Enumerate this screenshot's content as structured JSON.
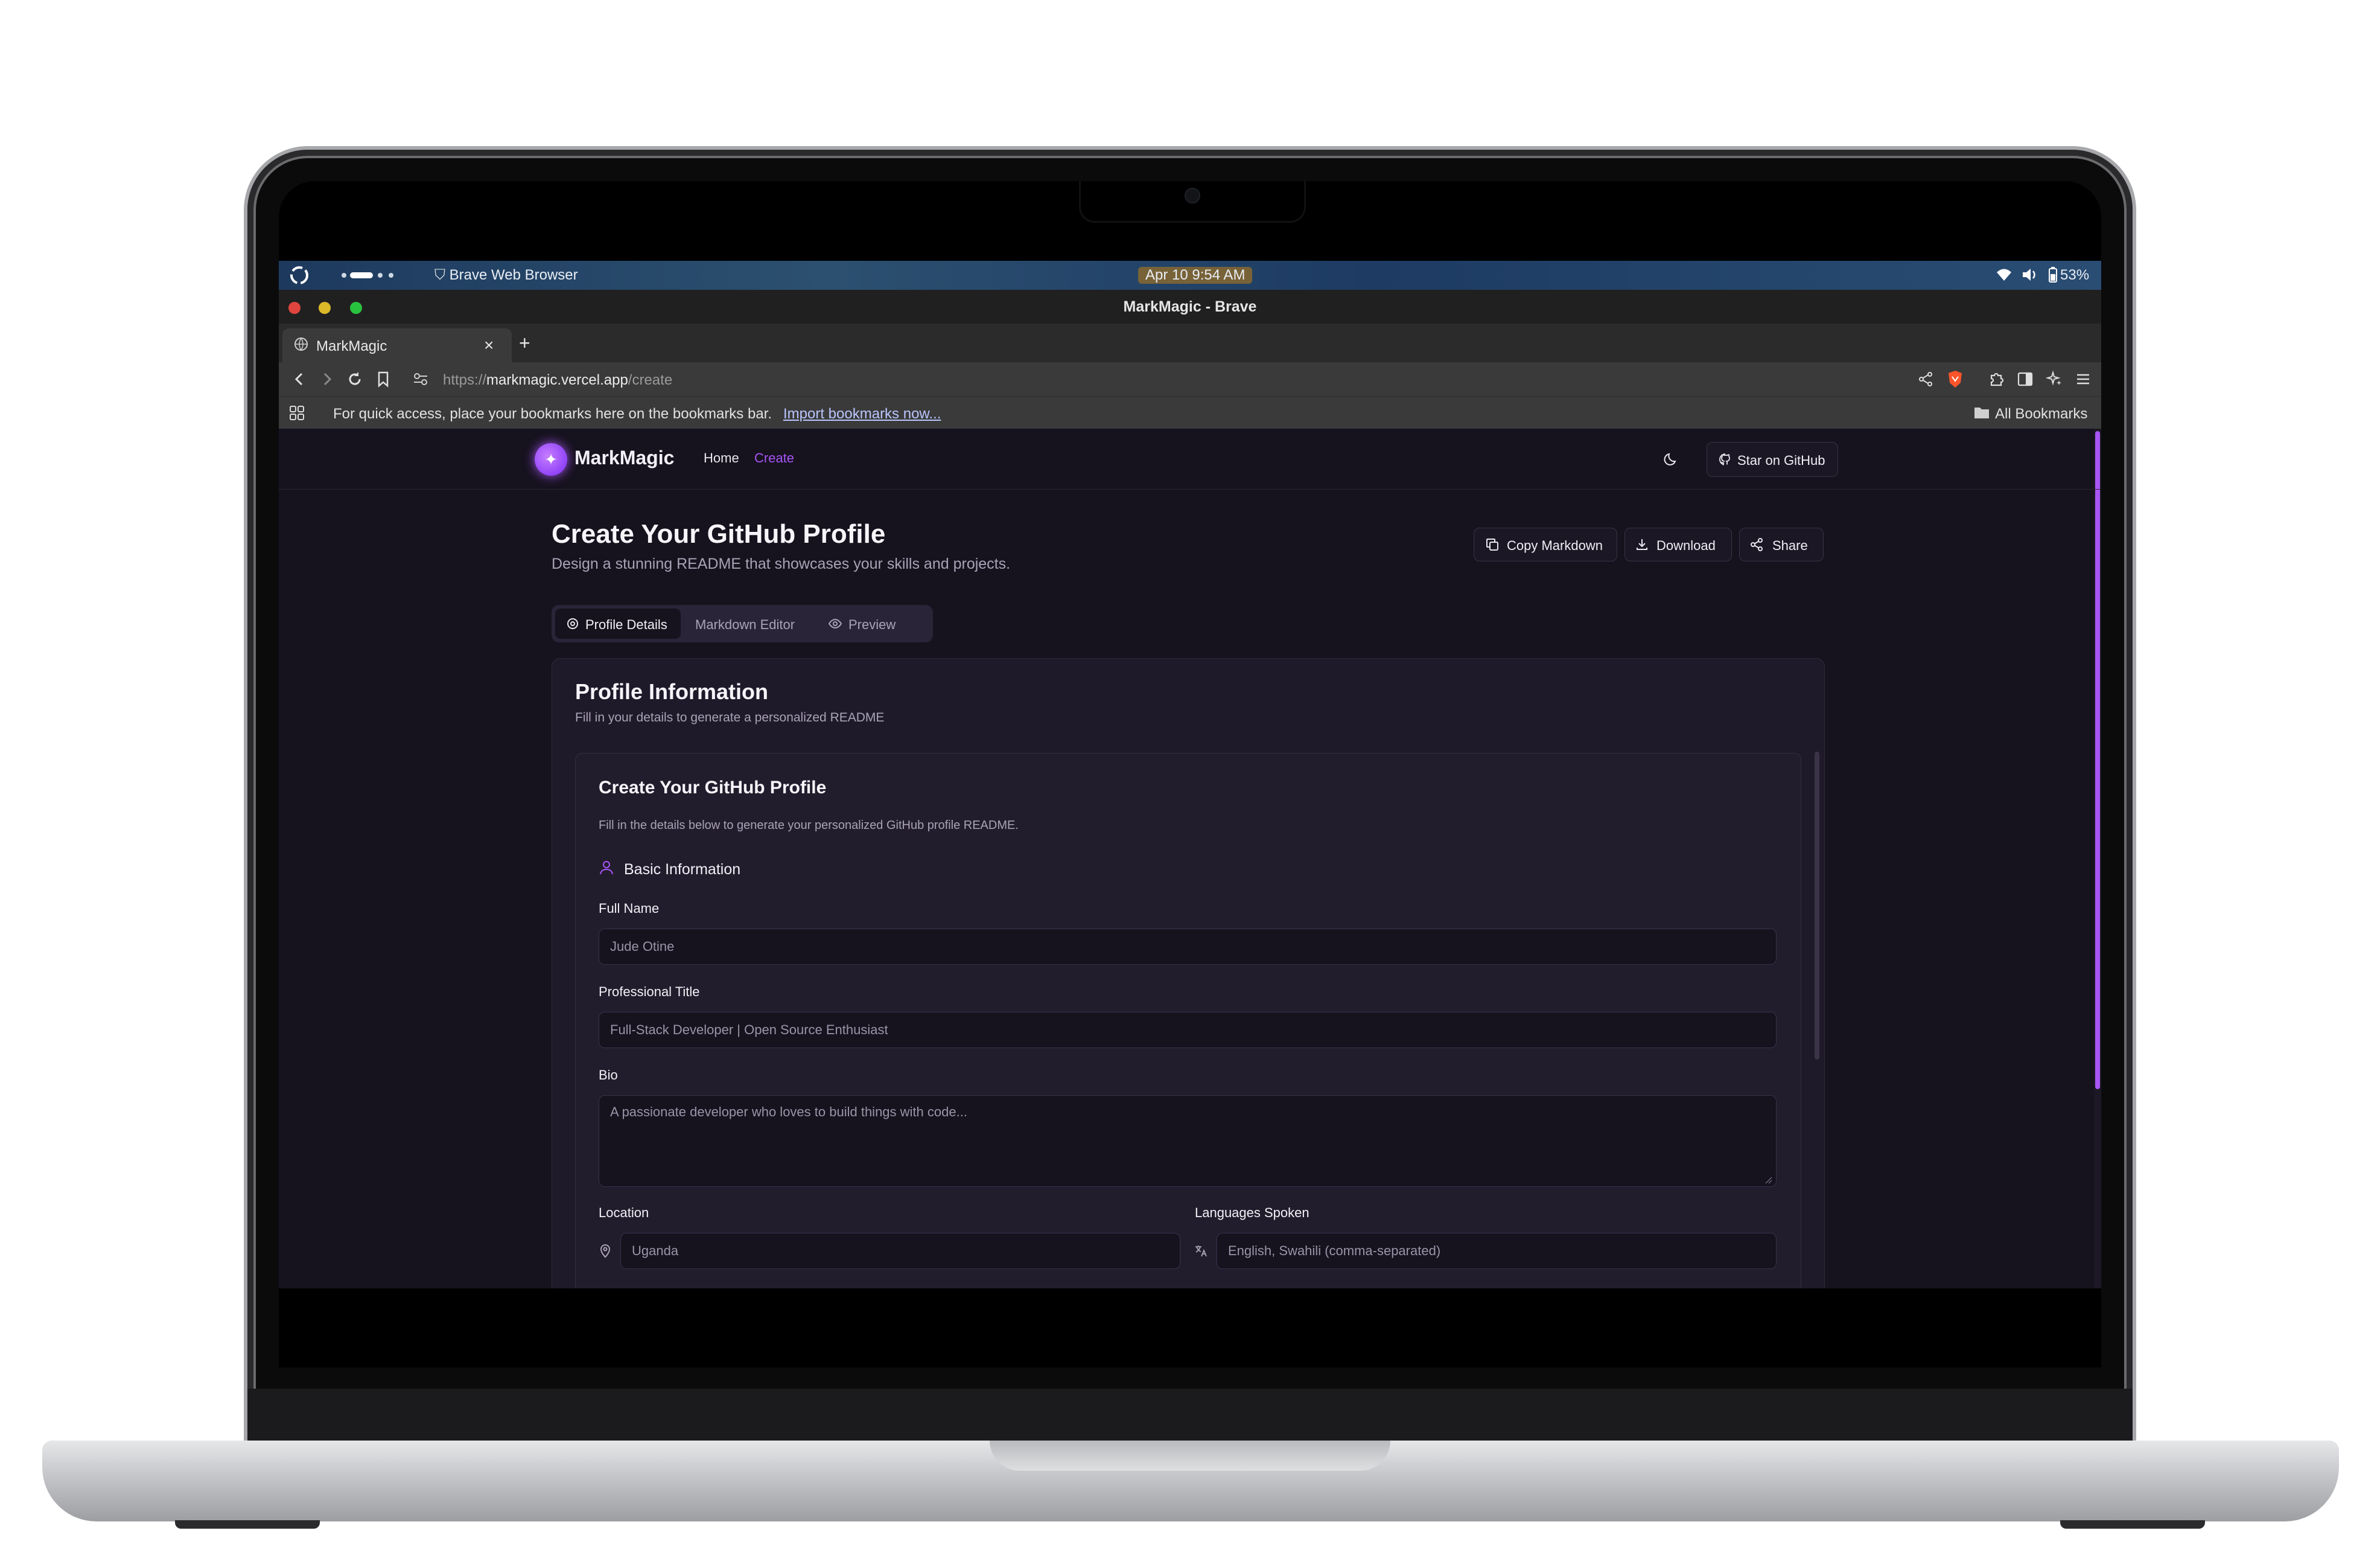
{
  "os": {
    "app_name": "Brave Web Browser",
    "datetime": "Apr 10    9:54 AM",
    "battery": "53%"
  },
  "window": {
    "title": "MarkMagic - Brave"
  },
  "browser": {
    "tab_title": "MarkMagic",
    "tab_close": "×",
    "new_tab": "+",
    "url_scheme": "https://",
    "url_host": "markmagic.vercel.app",
    "url_path": "/create",
    "bookmarks_prompt": "For quick access, place your bookmarks here on the bookmarks bar.",
    "import_link": "Import bookmarks now...",
    "all_bookmarks": "All Bookmarks"
  },
  "site": {
    "brand": "MarkMagic",
    "nav": [
      "Home",
      "Create"
    ],
    "star_github": "Star on GitHub"
  },
  "header": {
    "title": "Create Your GitHub Profile",
    "subtitle": "Design a stunning README that showcases your skills and projects.",
    "actions": [
      "Copy Markdown",
      "Download",
      "Share"
    ]
  },
  "tabs": [
    "Profile Details",
    "Markdown Editor",
    "Preview"
  ],
  "profile_card": {
    "title": "Profile Information",
    "subtitle": "Fill in your details to generate a personalized README"
  },
  "form": {
    "title": "Create Your GitHub Profile",
    "intro": "Fill in the details below to generate your personalized GitHub profile README.",
    "section": "Basic Information",
    "full_name_label": "Full Name",
    "full_name_placeholder": "Jude Otine",
    "title_label": "Professional Title",
    "title_placeholder": "Full-Stack Developer | Open Source Enthusiast",
    "bio_label": "Bio",
    "bio_placeholder": "A passionate developer who loves to build things with code...",
    "location_label": "Location",
    "location_placeholder": "Uganda",
    "languages_label": "Languages Spoken",
    "languages_placeholder": "English, Swahili (comma-separated)"
  },
  "colors": {
    "accent": "#a855f7",
    "background": "#16121e",
    "card": "#1f1a2a"
  }
}
